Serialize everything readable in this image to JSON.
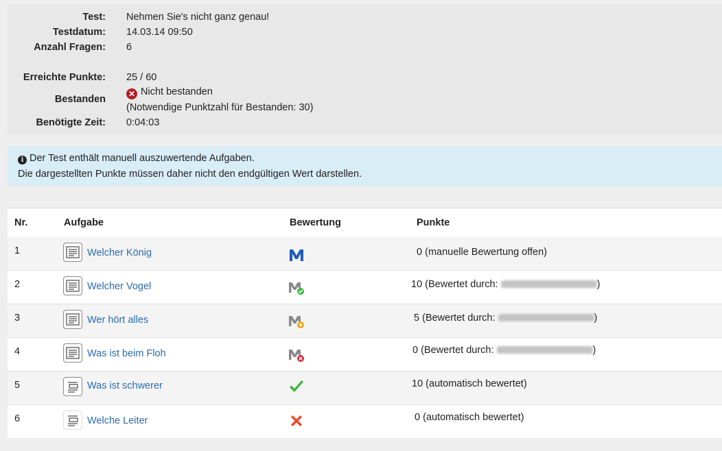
{
  "summary": {
    "test_label": "Test:",
    "test_value": "Nehmen Sie's nicht ganz genau!",
    "date_label": "Testdatum:",
    "date_value": "14.03.14 09:50",
    "questions_label": "Anzahl Fragen:",
    "questions_value": "6",
    "points_label": "Erreichte Punkte:",
    "points_value": "25 / 60",
    "passed_label": "Bestanden",
    "passed_value": "Nicht bestanden",
    "passed_note": "(Notwendige Punktzahl für Bestanden: 30)",
    "time_label": "Benötigte Zeit:",
    "time_value": "0:04:03"
  },
  "info": {
    "line1": "Der Test enthält manuell auszuwertende Aufgaben.",
    "line2": "Die dargestellten Punkte müssen daher nicht den endgültigen Wert darstellen."
  },
  "table": {
    "headers": {
      "nr": "Nr.",
      "task": "Aufgabe",
      "rating": "Bewertung",
      "points": "Punkte"
    },
    "rows": [
      {
        "nr": "1",
        "task": "Welcher König",
        "rating_icon": "manual-open-icon",
        "points_num": "0",
        "points_text": "(manuelle Bewertung offen)",
        "rated_by": "",
        "close": ""
      },
      {
        "nr": "2",
        "task": "Welcher Vogel",
        "rating_icon": "manual-pass-icon",
        "points_num": "10",
        "points_text": "(Bewertet durch:",
        "rated_by": "redacted",
        "close": ")"
      },
      {
        "nr": "3",
        "task": "Wer hört alles",
        "rating_icon": "manual-partial-icon",
        "points_num": "5",
        "points_text": "(Bewertet durch:",
        "rated_by": "redacted",
        "close": ")"
      },
      {
        "nr": "4",
        "task": "Was ist beim Floh",
        "rating_icon": "manual-fail-icon",
        "points_num": "0",
        "points_text": "(Bewertet durch:",
        "rated_by": "redacted",
        "close": ")"
      },
      {
        "nr": "5",
        "task": "Was ist schwerer",
        "rating_icon": "check-icon",
        "points_num": "10",
        "points_text": "(automatisch bewertet)",
        "rated_by": "",
        "close": ""
      },
      {
        "nr": "6",
        "task": "Welche Leiter",
        "rating_icon": "cross-icon",
        "points_num": "0",
        "points_text": "(automatisch bewertet)",
        "rated_by": "",
        "close": ""
      }
    ]
  },
  "colors": {
    "link": "#2b6cb0",
    "info_bg": "#d9edf7",
    "fail_red": "#b01e23",
    "m_blue": "#1e5bb8",
    "ok_green": "#3cb43c",
    "cross_orange": "#e84a2e"
  }
}
